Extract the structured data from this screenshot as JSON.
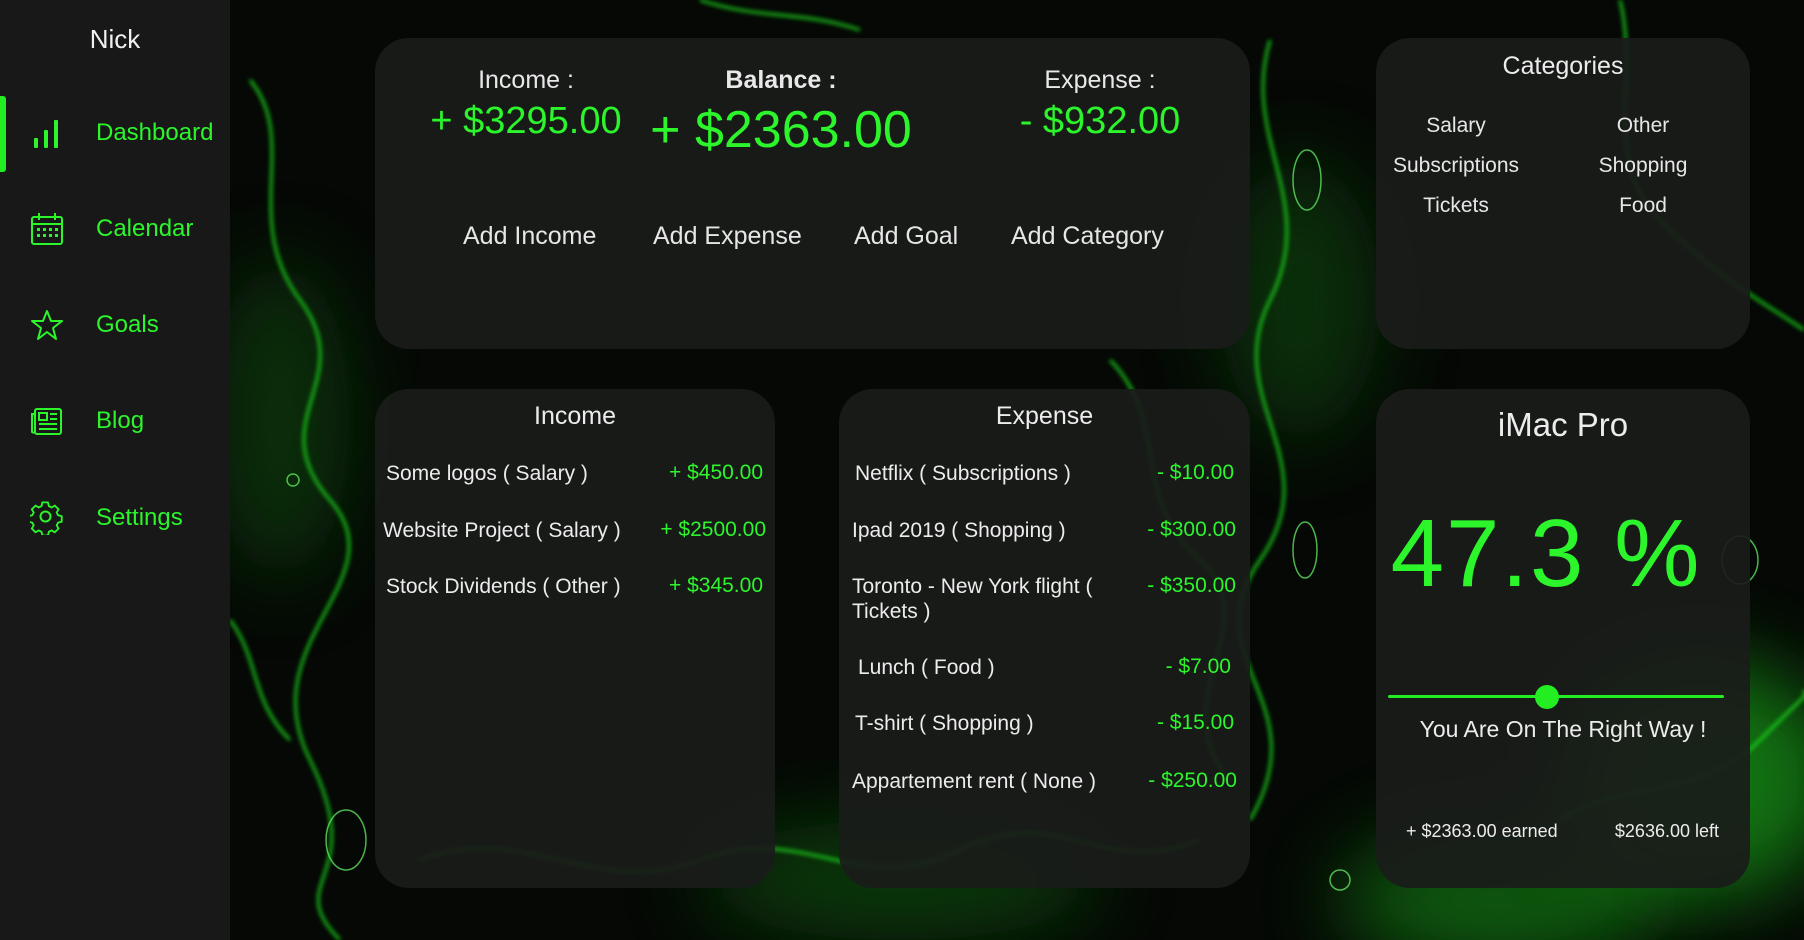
{
  "sidebar": {
    "user_name": "Nick",
    "items": [
      {
        "label": "Dashboard",
        "icon": "bar-chart-icon",
        "active": true
      },
      {
        "label": "Calendar",
        "icon": "calendar-icon"
      },
      {
        "label": "Goals",
        "icon": "star-icon"
      },
      {
        "label": "Blog",
        "icon": "newspaper-icon"
      },
      {
        "label": "Settings",
        "icon": "gear-icon"
      }
    ]
  },
  "summary": {
    "income_label": "Income :",
    "income_value": "+ $3295.00",
    "balance_label": "Balance :",
    "balance_value": "+ $2363.00",
    "expense_label": "Expense :",
    "expense_value": "- $932.00",
    "actions": [
      "Add Income",
      "Add Expense",
      "Add Goal",
      "Add Category"
    ]
  },
  "categories": {
    "title": "Categories",
    "items": [
      "Salary",
      "Other",
      "Subscriptions",
      "Shopping",
      "Tickets",
      "Food"
    ]
  },
  "income": {
    "title": "Income",
    "rows": [
      {
        "name": "Some logos ( Salary )",
        "amount": "+ $450.00"
      },
      {
        "name": "Website Project ( Salary )",
        "amount": "+ $2500.00"
      },
      {
        "name": "Stock Dividends ( Other )",
        "amount": "+ $345.00"
      }
    ]
  },
  "expense": {
    "title": "Expense",
    "rows": [
      {
        "name": "Netflix ( Subscriptions )",
        "amount": "- $10.00"
      },
      {
        "name": "Ipad 2019 ( Shopping )",
        "amount": "- $300.00"
      },
      {
        "name": "Toronto - New York flight ( Tickets )",
        "amount": "- $350.00"
      },
      {
        "name": "Lunch ( Food )",
        "amount": "- $7.00"
      },
      {
        "name": "T-shirt ( Shopping )",
        "amount": "- $15.00"
      },
      {
        "name": "Appartement rent ( None )",
        "amount": "- $250.00"
      }
    ]
  },
  "goal": {
    "title": "iMac Pro",
    "percent_text": "47.3 %",
    "progress": 0.473,
    "message": "You Are On The Right Way !",
    "earned": "+ $2363.00 earned",
    "left": "$2636.00 left"
  },
  "colors": {
    "accent": "#2cf52c",
    "sidebar_bg": "#171817",
    "card_bg": "#1a1c1a"
  }
}
